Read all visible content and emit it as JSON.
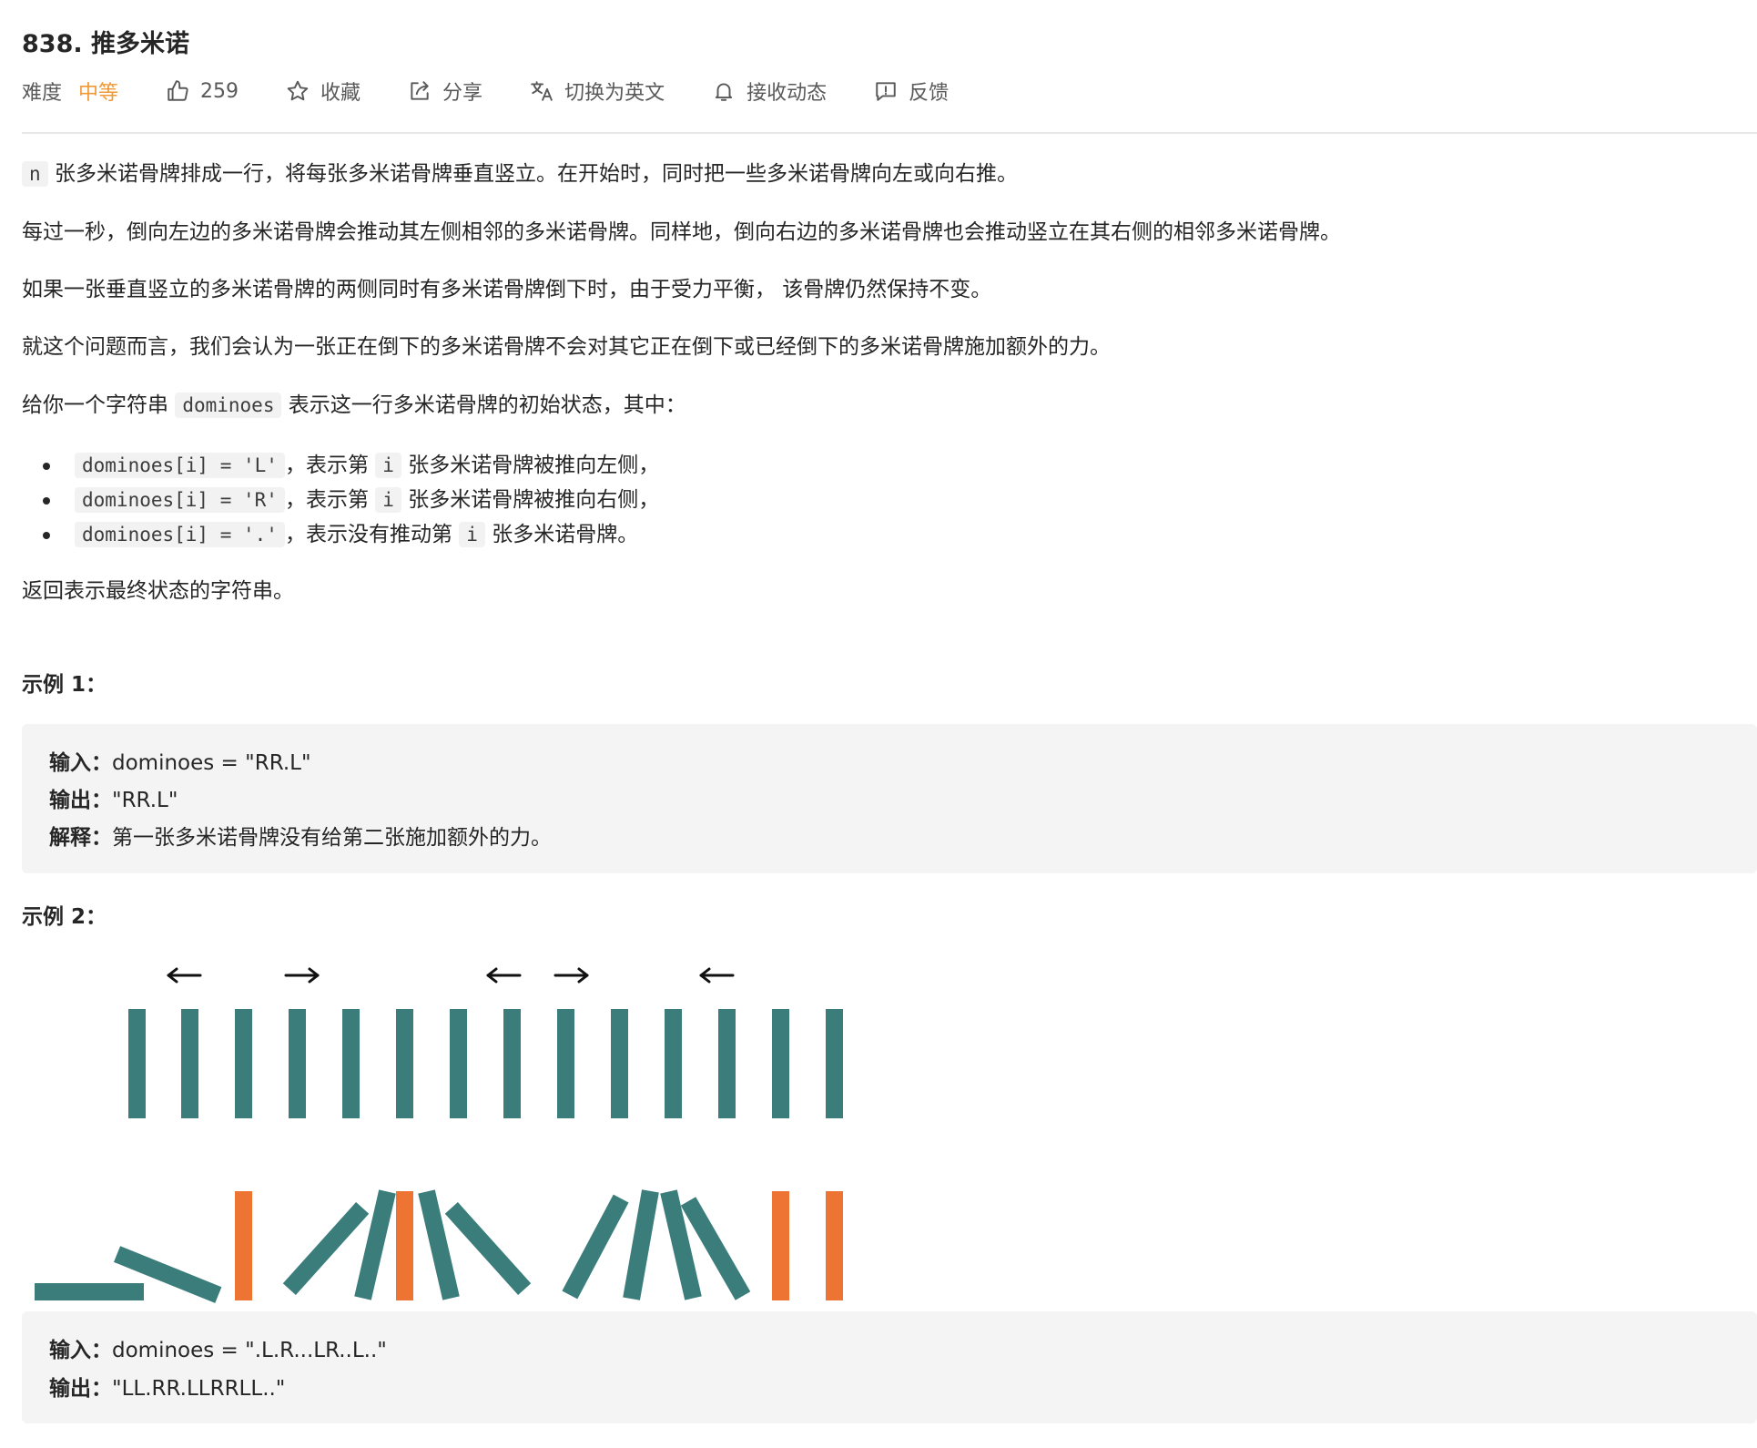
{
  "problem": {
    "title": "838. 推多米诺"
  },
  "toolbar": {
    "difficulty_label": "难度",
    "difficulty_value": "中等",
    "likes": "259",
    "favorite": "收藏",
    "share": "分享",
    "switch_language": "切换为英文",
    "notifications": "接收动态",
    "feedback": "反馈"
  },
  "description": {
    "p1_code": "n",
    "p1_text": "张多米诺骨牌排成一行，将每张多米诺骨牌垂直竖立。在开始时，同时把一些多米诺骨牌向左或向右推。",
    "p2": "每过一秒，倒向左边的多米诺骨牌会推动其左侧相邻的多米诺骨牌。同样地，倒向右边的多米诺骨牌也会推动竖立在其右侧的相邻多米诺骨牌。",
    "p3": "如果一张垂直竖立的多米诺骨牌的两侧同时有多米诺骨牌倒下时，由于受力平衡， 该骨牌仍然保持不变。",
    "p4": "就这个问题而言，我们会认为一张正在倒下的多米诺骨牌不会对其它正在倒下或已经倒下的多米诺骨牌施加额外的力。",
    "p5_before": "给你一个字符串",
    "p5_code": "dominoes",
    "p5_after": "表示这一行多米诺骨牌的初始状态，其中：",
    "bullets": [
      {
        "code": "dominoes[i] = 'L'",
        "text1": "，表示第",
        "code2": "i",
        "text2": "张多米诺骨牌被推向左侧，"
      },
      {
        "code": "dominoes[i] = 'R'",
        "text1": "，表示第",
        "code2": "i",
        "text2": "张多米诺骨牌被推向右侧，"
      },
      {
        "code": "dominoes[i] = '.'",
        "text1": "，表示没有推动第",
        "code2": "i",
        "text2": "张多米诺骨牌。"
      }
    ],
    "p6": "返回表示最终状态的字符串。"
  },
  "examples": [
    {
      "title": "示例 1：",
      "input_label": "输入：",
      "input_value": "dominoes = \"RR.L\"",
      "output_label": "输出：",
      "output_value": "\"RR.L\"",
      "explain_label": "解释：",
      "explain_value": "第一张多米诺骨牌没有给第二张施加额外的力。"
    },
    {
      "title": "示例 2：",
      "input_label": "输入：",
      "input_value": "dominoes = \".L.R...LR..L..\"",
      "output_label": "输出：",
      "output_value": "\"LL.RR.LLRRLL..\""
    }
  ],
  "colors": {
    "accent_orange": "#ef9a36",
    "domino_teal": "#3a7d7b",
    "domino_orange": "#ed7433"
  },
  "icons": [
    "thumb-up-icon",
    "star-icon",
    "share-icon",
    "translate-icon",
    "bell-icon",
    "feedback-icon"
  ]
}
